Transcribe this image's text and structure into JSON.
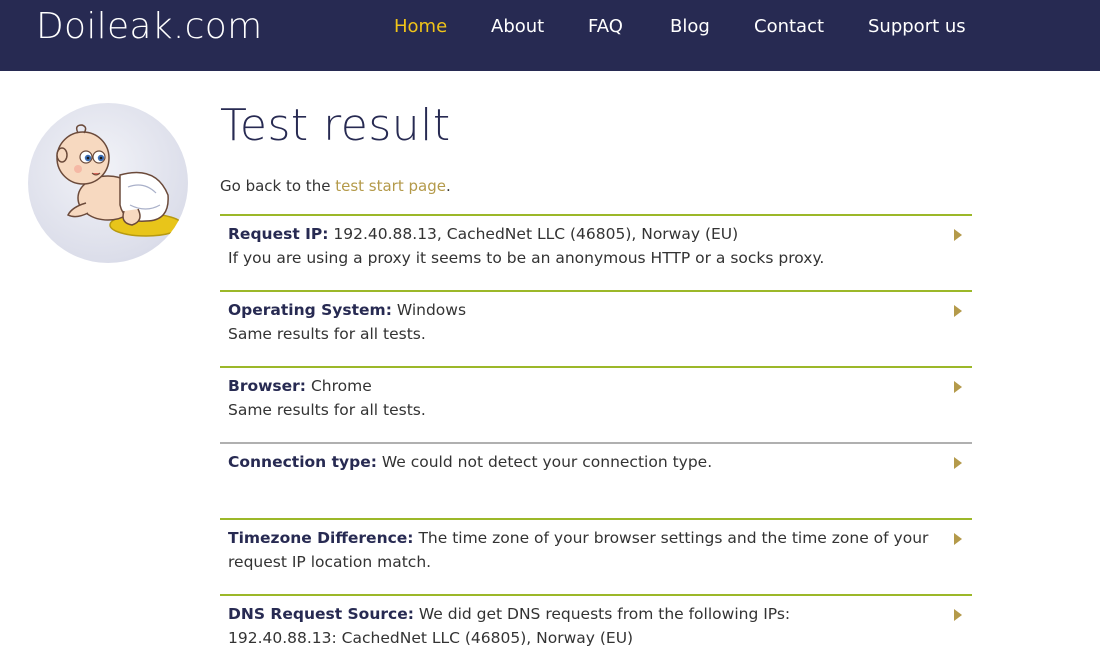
{
  "site": {
    "name": "Doileak.com"
  },
  "nav": [
    {
      "label": "Home",
      "active": true
    },
    {
      "label": "About",
      "active": false
    },
    {
      "label": "FAQ",
      "active": false
    },
    {
      "label": "Blog",
      "active": false
    },
    {
      "label": "Contact",
      "active": false
    },
    {
      "label": "Support us",
      "active": false
    }
  ],
  "colors": {
    "navbar": "#272a52",
    "accent_yellow": "#f0c419",
    "link": "#b49a4a",
    "divider_green": "#9cb829",
    "divider_gray": "#b0b0b0"
  },
  "page": {
    "title": "Test result",
    "goback_prefix": "Go back to the ",
    "goback_link": "test start page",
    "goback_suffix": "."
  },
  "results": [
    {
      "label": "Request IP:",
      "value": " 192.40.88.13, CachedNet LLC (46805), Norway (EU)",
      "detail": "If you are using a proxy it seems to be an anonymous HTTP or a socks proxy.",
      "divider": "green"
    },
    {
      "label": "Operating System:",
      "value": " Windows",
      "detail": "Same results for all tests.",
      "divider": "green"
    },
    {
      "label": "Browser:",
      "value": " Chrome",
      "detail": "Same results for all tests.",
      "divider": "green"
    },
    {
      "label": "Connection type:",
      "value": " We could not detect your connection type.",
      "detail": "",
      "divider": "gray"
    },
    {
      "label": "Timezone Difference:",
      "value": " The time zone of your browser settings and the time zone of your request IP location match.",
      "detail": "",
      "divider": "green"
    },
    {
      "label": "DNS Request Source:",
      "value": " We did get DNS requests from the following IPs:",
      "detail": "192.40.88.13: CachedNet LLC (46805), Norway (EU)",
      "divider": "green"
    }
  ],
  "icons": {
    "avatar": "baby-mascot-icon",
    "row_arrow": "triangle-right-icon"
  }
}
